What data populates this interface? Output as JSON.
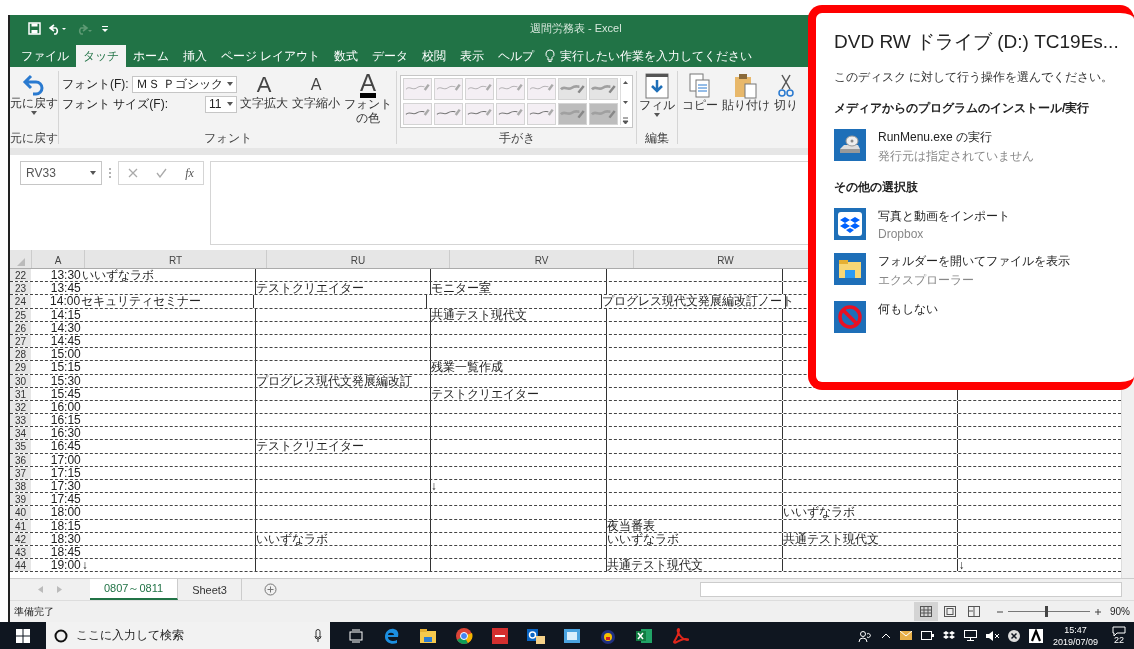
{
  "window": {
    "title": "週間労務表  -  Excel"
  },
  "tabs": [
    {
      "label": "ファイル",
      "selected": false
    },
    {
      "label": "タッチ",
      "selected": true
    },
    {
      "label": "ホーム",
      "selected": false
    },
    {
      "label": "挿入",
      "selected": false
    },
    {
      "label": "ページ レイアウト",
      "selected": false
    },
    {
      "label": "数式",
      "selected": false
    },
    {
      "label": "データ",
      "selected": false
    },
    {
      "label": "校閲",
      "selected": false
    },
    {
      "label": "表示",
      "selected": false
    },
    {
      "label": "ヘルプ",
      "selected": false
    }
  ],
  "tell_me": {
    "placeholder": "実行したい作業を入力してください"
  },
  "ribbon": {
    "undo": {
      "label": "元に戻す",
      "group": "元に戻す"
    },
    "font": {
      "group": "フォント",
      "font_label": "フォント(F):",
      "font_value": "ＭＳ Ｐゴシック",
      "size_label": "フォント サイズ(F):",
      "size_value": "11",
      "grow_glyph": "A",
      "grow_label": "文字拡大",
      "shrink_glyph": "A",
      "shrink_label": "文字縮小",
      "color_glyph": "A",
      "color_label_1": "フォント",
      "color_label_2": "の色"
    },
    "handwriting": {
      "group": "手がき"
    },
    "editing": {
      "group": "編集",
      "fill_label": "フィル"
    },
    "clipboard": {
      "copy_label": "コピー",
      "paste_label": "貼り付け",
      "cut_label": "切り"
    }
  },
  "formula_bar": {
    "name_box": "RV33",
    "function_label": "fx"
  },
  "column_headers": [
    "A",
    "RT",
    "RU",
    "RV",
    "RW"
  ],
  "rows": [
    {
      "number": "22",
      "time": "13:30",
      "rt": "いいずなラボ"
    },
    {
      "number": "23",
      "time": "13:45",
      "ru": "テストクリエイター",
      "rv": "モニター室"
    },
    {
      "number": "24",
      "time": "14:00",
      "rt": "セキュリティセミナー",
      "rw": "プログレス現代文発展編改訂ノート"
    },
    {
      "number": "25",
      "time": "14:15",
      "rv": "共通テスト現代文"
    },
    {
      "number": "26",
      "time": "14:30"
    },
    {
      "number": "27",
      "time": "14:45"
    },
    {
      "number": "28",
      "time": "15:00"
    },
    {
      "number": "29",
      "time": "15:15",
      "rv": "残業一覧作成"
    },
    {
      "number": "30",
      "time": "15:30",
      "ru": "プログレス現代文発展編改訂"
    },
    {
      "number": "31",
      "time": "15:45",
      "rv": "テストクリエイター"
    },
    {
      "number": "32",
      "time": "16:00"
    },
    {
      "number": "33",
      "time": "16:15"
    },
    {
      "number": "34",
      "time": "16:30"
    },
    {
      "number": "35",
      "time": "16:45",
      "ru": "テストクリエイター"
    },
    {
      "number": "36",
      "time": "17:00"
    },
    {
      "number": "37",
      "time": "17:15"
    },
    {
      "number": "38",
      "time": "17:30",
      "rv": "↓"
    },
    {
      "number": "39",
      "time": "17:45"
    },
    {
      "number": "40",
      "time": "18:00",
      "column_6": "いいずなラボ"
    },
    {
      "number": "41",
      "time": "18:15",
      "rw": "夜当番表"
    },
    {
      "number": "42",
      "time": "18:30",
      "ru": "いいずなラボ",
      "rw": "いいずなラボ",
      "column_6": "共通テスト現代文"
    },
    {
      "number": "43",
      "time": "18:45"
    },
    {
      "number": "44",
      "time": "19:00",
      "rt": "↓",
      "rw": "共通テスト現代文",
      "column_7": "↓"
    }
  ],
  "sheet_tabs": [
    {
      "label": "0807～0811",
      "selected": true
    },
    {
      "label": "Sheet3",
      "selected": false
    }
  ],
  "status_bar": {
    "status": "準備完了",
    "views": [
      {
        "kind": "normal",
        "selected": true
      },
      {
        "kind": "layout",
        "selected": false
      },
      {
        "kind": "pagebreak",
        "selected": false
      }
    ],
    "zoom": {
      "level": 0.45,
      "reading": "90%"
    }
  },
  "taskbar": {
    "search_placeholder": "ここに入力して検索",
    "apps": [
      {
        "kind": "taskview"
      },
      {
        "kind": "edge"
      },
      {
        "kind": "explorer"
      },
      {
        "kind": "chrome"
      },
      {
        "kind": "red"
      },
      {
        "kind": "outlook"
      },
      {
        "kind": "blue"
      },
      {
        "kind": "yellow"
      },
      {
        "kind": "excel"
      },
      {
        "kind": "acrobat"
      }
    ],
    "time": "15:47",
    "date": "2019/07/09",
    "notifications": "22"
  },
  "autoplay": {
    "title": "DVD RW ドライブ (D:) TC19Es...",
    "prompt": "このディスク に対して行う操作を選んでください。",
    "sections": [
      {
        "heading": "メディアからのプログラムのインストール/実行",
        "options": [
          {
            "kind": "disc",
            "label": "RunMenu.exe の実行",
            "sublabel": "発行元は指定されていません"
          }
        ]
      },
      {
        "heading": "その他の選択肢",
        "options": [
          {
            "kind": "dropbox",
            "label": "写真と動画をインポート",
            "sublabel": "Dropbox"
          },
          {
            "kind": "folder",
            "label": "フォルダーを開いてファイルを表示",
            "sublabel": "エクスプローラー"
          },
          {
            "kind": "none",
            "label": "何もしない"
          }
        ]
      }
    ]
  }
}
